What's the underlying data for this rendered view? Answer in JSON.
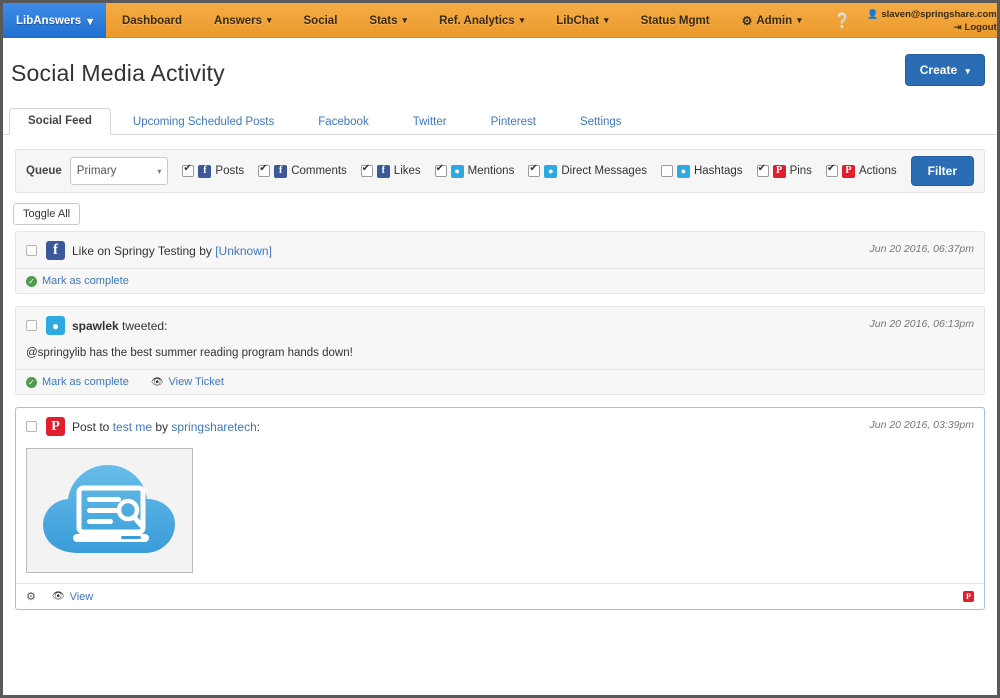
{
  "nav": {
    "brand": "LibAnswers",
    "items": [
      {
        "label": "Dashboard",
        "caret": false,
        "gear": false
      },
      {
        "label": "Answers",
        "caret": true,
        "gear": false
      },
      {
        "label": "Social",
        "caret": false,
        "gear": false
      },
      {
        "label": "Stats",
        "caret": true,
        "gear": false
      },
      {
        "label": "Ref. Analytics",
        "caret": true,
        "gear": false
      },
      {
        "label": "LibChat",
        "caret": true,
        "gear": false
      },
      {
        "label": "Status Mgmt",
        "caret": false,
        "gear": false
      },
      {
        "label": "Admin",
        "caret": true,
        "gear": true
      }
    ],
    "help_icon": "question-mark-icon",
    "user": "slaven@springshare.com",
    "logout": "Logout",
    "caret_glyph": "▾"
  },
  "header": {
    "title": "Social Media Activity",
    "create_label": "Create",
    "create_caret": "▾"
  },
  "tabs": [
    {
      "label": "Social Feed",
      "active": true
    },
    {
      "label": "Upcoming Scheduled Posts",
      "active": false
    },
    {
      "label": "Facebook",
      "active": false
    },
    {
      "label": "Twitter",
      "active": false
    },
    {
      "label": "Pinterest",
      "active": false
    },
    {
      "label": "Settings",
      "active": false
    }
  ],
  "filter": {
    "queue_label": "Queue",
    "queue_value": "Primary",
    "queue_caret": "▾",
    "checkboxes": [
      {
        "label": "Posts",
        "checked": true,
        "network": "facebook",
        "glyph": "f"
      },
      {
        "label": "Comments",
        "checked": true,
        "network": "facebook",
        "glyph": "f"
      },
      {
        "label": "Likes",
        "checked": true,
        "network": "facebook",
        "glyph": "f"
      },
      {
        "label": "Mentions",
        "checked": true,
        "network": "twitter",
        "glyph": "ᵛ"
      },
      {
        "label": "Direct Messages",
        "checked": true,
        "network": "twitter",
        "glyph": "ᵛ"
      },
      {
        "label": "Hashtags",
        "checked": false,
        "network": "twitter",
        "glyph": "ᵛ"
      },
      {
        "label": "Pins",
        "checked": true,
        "network": "pinterest",
        "glyph": "P"
      },
      {
        "label": "Actions",
        "checked": true,
        "network": "pinterest",
        "glyph": "P"
      }
    ],
    "filter_button": "Filter"
  },
  "toggle_all_label": "Toggle All",
  "feed": [
    {
      "network": "facebook",
      "icon_glyph": "f",
      "title_prefix": "Like on Springy Testing by ",
      "title_link": "[Unknown]",
      "title_suffix": "",
      "date": "Jun 20 2016, 06:37pm",
      "body": "",
      "actions": [
        {
          "label": "Mark as complete",
          "icon": "check-circle-icon"
        }
      ]
    },
    {
      "network": "twitter",
      "icon_glyph": "ᵛ",
      "title_prefix": "",
      "title_link": "spawlek",
      "title_suffix": " tweeted:",
      "date": "Jun 20 2016, 06:13pm",
      "body": "@springylib has the best summer reading program hands down!",
      "actions": [
        {
          "label": "Mark as complete",
          "icon": "check-circle-icon"
        },
        {
          "label": "View Ticket",
          "icon": "eye-icon"
        }
      ]
    },
    {
      "network": "pinterest",
      "icon_glyph": "P",
      "title_prefix": "Post to ",
      "title_link": "test me",
      "title_mid": " by ",
      "title_link2": "springsharetech",
      "title_suffix": ":",
      "date": "Jun 20 2016, 03:39pm",
      "body": "",
      "image_alt": "springshare-cloud-logo",
      "actions": [
        {
          "label": "View",
          "icon": "eye-icon"
        }
      ]
    }
  ]
}
